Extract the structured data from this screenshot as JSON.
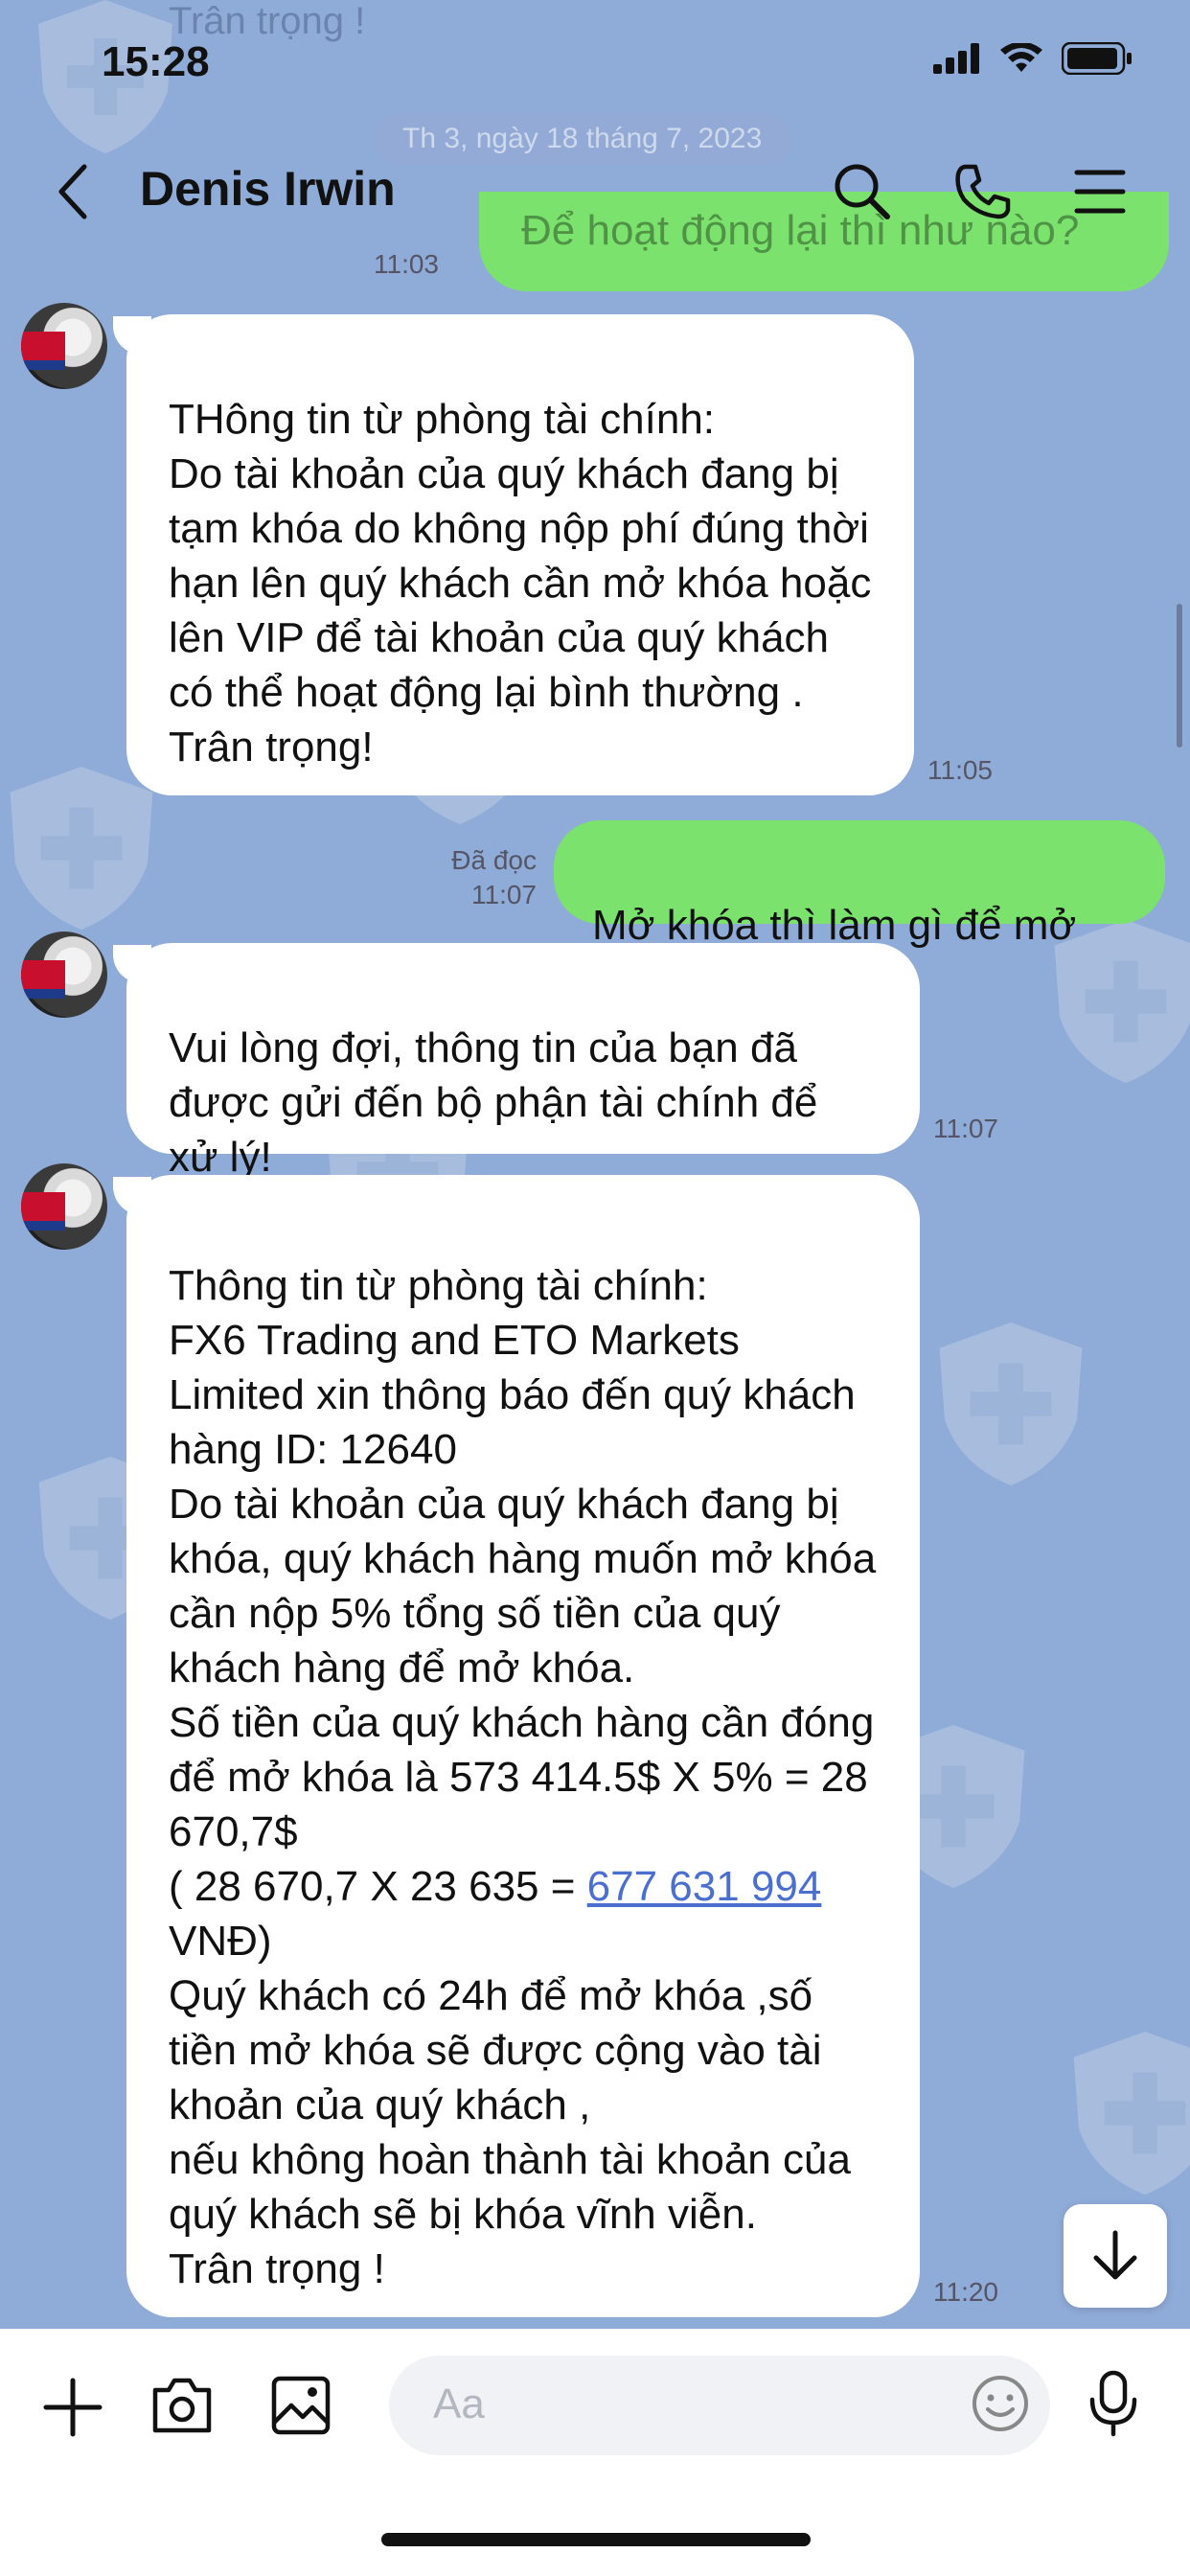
{
  "status_bar": {
    "time": "15:28"
  },
  "header": {
    "title": "Denis Irwin"
  },
  "background_partial": {
    "top_text": "Trân trọng !",
    "date": "Th 3, ngày 18 tháng 7, 2023",
    "green_partial": "Để hoạt động lại thì như nào?",
    "green_time": "11:03"
  },
  "messages": [
    {
      "side": "left",
      "text": "THông tin từ phòng tài chính:\nDo tài khoản của quý khách đang bị tạm khóa do không nộp phí đúng thời hạn lên quý khách cần mở khóa hoặc lên VIP để tài khoản của quý khách có thể hoạt động lại bình thường .\nTrân trọng!",
      "time": "11:05"
    },
    {
      "side": "right",
      "text": "Mở khóa thì làm gì để mở",
      "read": "Đã đọc",
      "time": "11:07"
    },
    {
      "side": "left",
      "text": "Vui lòng đợi, thông tin của bạn đã được gửi đến bộ phận tài chính để xử lý!",
      "time": "11:07"
    },
    {
      "side": "left",
      "text_before_link": "Thông tin từ phòng tài chính:\nFX6 Trading and ETO Markets Limited xin thông báo đến quý khách hàng ID: 12640\nDo tài khoản của quý khách đang bị khóa, quý khách hàng muốn mở khóa cần nộp 5% tổng số tiền của quý khách hàng để mở khóa.\nSố tiền của quý khách hàng cần đóng để mở khóa là 573 414.5$ X 5% = 28 670,7$\n( 28 670,7 X 23 635 = ",
      "link": "677 631 994",
      "text_after_link": " VNĐ)\nQuý khách có 24h để mở khóa ,số tiền mở khóa sẽ được cộng vào tài khoản của quý khách ,\nnếu không hoàn thành tài khoản của quý khách sẽ bị khóa vĩnh viễn.\nTrân trọng !",
      "time": "11:20"
    }
  ],
  "composer": {
    "placeholder": "Aa"
  },
  "icons": [
    "back-icon",
    "search-icon",
    "phone-icon",
    "menu-icon",
    "plus-icon",
    "camera-icon",
    "image-icon",
    "emoji-icon",
    "mic-icon",
    "arrow-down-icon"
  ],
  "colors": {
    "background": "#8fabd8",
    "my_bubble": "#7be26d",
    "their_bubble": "#ffffff",
    "link": "#4b6fcf"
  }
}
